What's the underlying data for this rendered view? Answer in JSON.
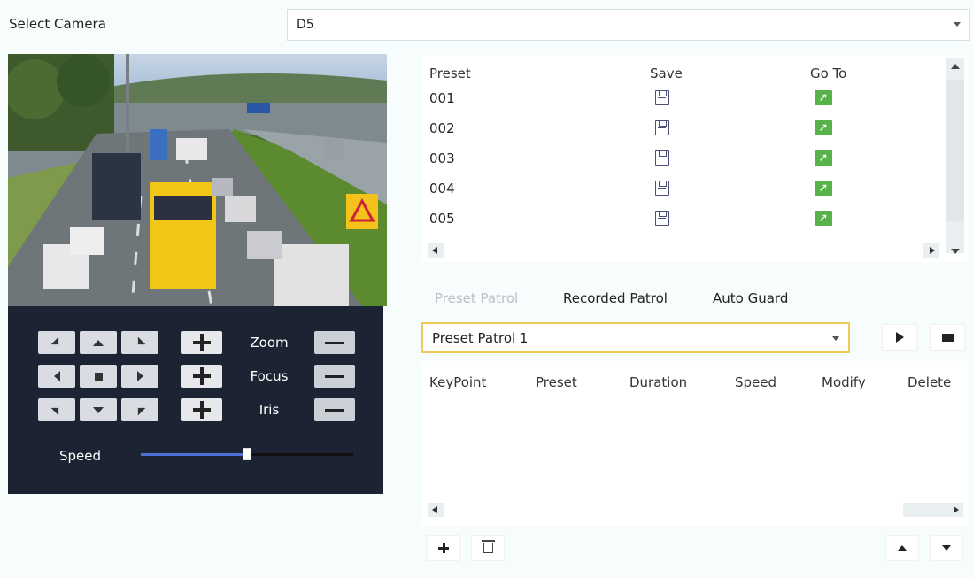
{
  "camera": {
    "label": "Select Camera",
    "selected": "D5"
  },
  "preset_table": {
    "headers": [
      "Preset",
      "Save",
      "Go To"
    ],
    "rows": [
      "001",
      "002",
      "003",
      "004",
      "005"
    ]
  },
  "ptz": {
    "zoom_label": "Zoom",
    "focus_label": "Focus",
    "iris_label": "Iris",
    "speed_label": "Speed",
    "speed_value": 0.5
  },
  "tabs": [
    "Preset Patrol",
    "Recorded Patrol",
    "Auto Guard"
  ],
  "active_tab": 0,
  "patrol_select": {
    "selected": "Preset Patrol 1"
  },
  "keypoint_table": {
    "headers": [
      "KeyPoint",
      "Preset",
      "Duration",
      "Speed",
      "Modify",
      "Delete"
    ]
  },
  "colors": {
    "accent": "#f0c95a",
    "panel": "#1c2333",
    "go_to": "#58b24a",
    "slider": "#4d6fd6"
  },
  "icons": {
    "save": "save-icon",
    "go_to": "go-to-arrow-icon",
    "play": "play-icon",
    "stop": "stop-icon",
    "add": "add-icon",
    "delete": "trash-icon",
    "move_up": "arrow-up-icon",
    "move_down": "arrow-down-icon"
  }
}
